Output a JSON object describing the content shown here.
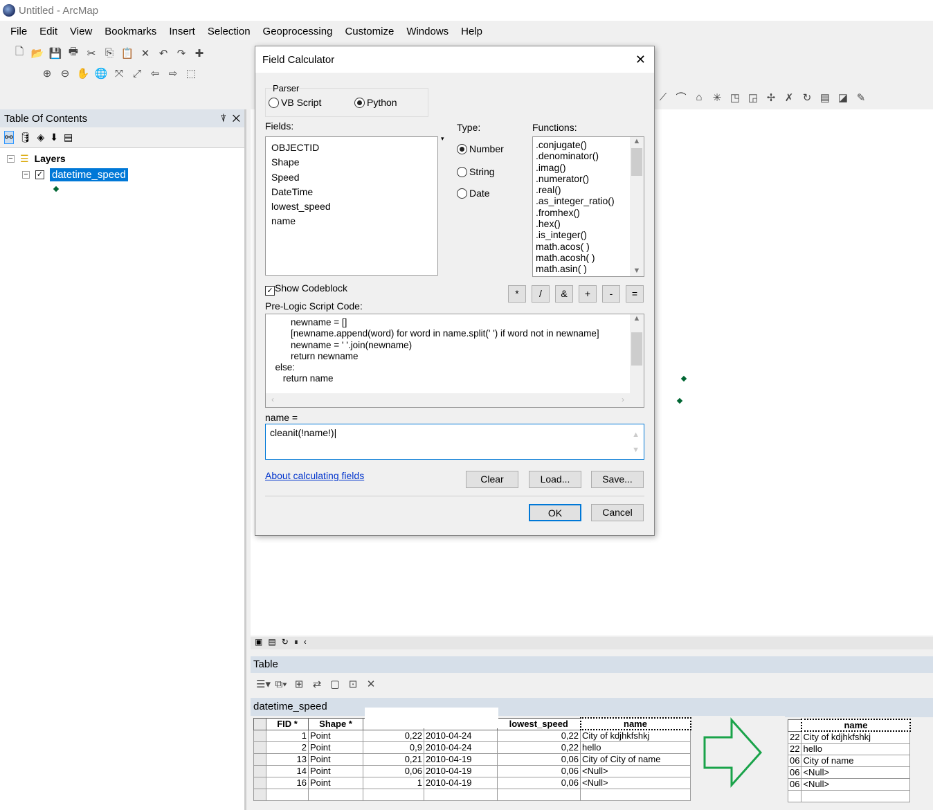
{
  "window": {
    "title": "Untitled - ArcMap"
  },
  "menu": [
    "File",
    "Edit",
    "View",
    "Bookmarks",
    "Insert",
    "Selection",
    "Geoprocessing",
    "Customize",
    "Windows",
    "Help"
  ],
  "toc": {
    "title": "Table Of Contents",
    "pin": "⍒",
    "close": "✕",
    "root": "Layers",
    "layer": "datetime_speed"
  },
  "dialog": {
    "title": "Field Calculator",
    "parser_label": "Parser",
    "parsers": [
      "VB Script",
      "Python"
    ],
    "parser_selected": "Python",
    "fields_label": "Fields:",
    "fields": [
      "OBJECTID",
      "Shape",
      "Speed",
      "DateTime",
      "lowest_speed",
      "name"
    ],
    "type_label": "Type:",
    "types": [
      "Number",
      "String",
      "Date"
    ],
    "type_selected": "Number",
    "functions_label": "Functions:",
    "functions": [
      ".conjugate()",
      ".denominator()",
      ".imag()",
      ".numerator()",
      ".real()",
      ".as_integer_ratio()",
      ".fromhex()",
      ".hex()",
      ".is_integer()",
      "math.acos( )",
      "math.acosh( )",
      "math.asin( )"
    ],
    "show_codeblock": "Show Codeblock",
    "show_codeblock_checked": true,
    "operators": [
      "*",
      "/",
      "&",
      "+",
      "-",
      "="
    ],
    "prelogic_label": "Pre-Logic Script Code:",
    "code_lines": [
      "        newname = []",
      "        [newname.append(word) for word in name.split(' ') if word not in newname]",
      "        newname = ' '.join(newname)",
      "        return newname",
      "  else:",
      "     return name"
    ],
    "expr_label": "name =",
    "expression": "cleanit(!name!)",
    "help_link": "About calculating fields",
    "clear": "Clear",
    "load": "Load...",
    "save": "Save...",
    "ok": "OK",
    "cancel": "Cancel"
  },
  "table": {
    "panel_title": "Table",
    "table_name": "datetime_speed",
    "columns": [
      "FID *",
      "Shape *",
      "",
      "",
      "lowest_speed",
      "name"
    ],
    "rows": [
      [
        "1",
        "Point",
        "0,22",
        "2010-04-24",
        "0,22",
        "City of kdjhkfshkj"
      ],
      [
        "2",
        "Point",
        "0,9",
        "2010-04-24",
        "0,22",
        "hello"
      ],
      [
        "13",
        "Point",
        "0,21",
        "2010-04-19",
        "0,06",
        "City of City of name"
      ],
      [
        "14",
        "Point",
        "0,06",
        "2010-04-19",
        "0,06",
        "<Null>"
      ],
      [
        "16",
        "Point",
        "1",
        "2010-04-19",
        "0,06",
        "<Null>"
      ]
    ],
    "result_column": "name",
    "result_prev": [
      "22",
      "22",
      "06",
      "06",
      "06"
    ],
    "result_rows": [
      "City of kdjhkfshkj",
      "hello",
      "City of name",
      "<Null>",
      "<Null>"
    ]
  },
  "colors": {
    "arrow": "#1aa34a",
    "selection": "#0078d7",
    "link": "#0033cc"
  }
}
